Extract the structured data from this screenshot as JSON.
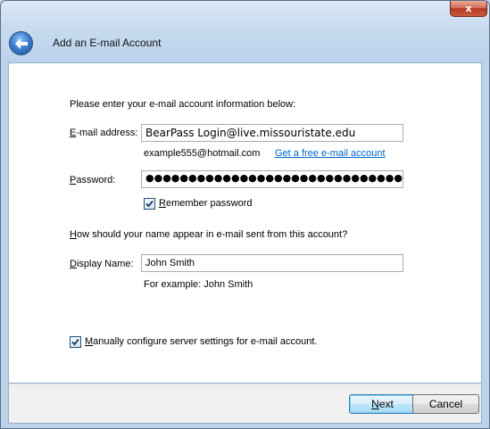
{
  "window": {
    "title": "Add an E-mail Account",
    "close_glyph": "x"
  },
  "form": {
    "intro": "Please enter your e-mail account information below:",
    "email": {
      "label_hotkey": "E",
      "label_rest": "-mail address:",
      "value": "BearPass Login@live.missouristate.edu",
      "example": "example555@hotmail.com",
      "free_link": "Get a free e-mail account"
    },
    "password": {
      "label_hotkey": "P",
      "label_rest": "assword:",
      "masked_value": "●●●●●●●●●●●●●●●●●●●●●●●●●●●●●●●●●●●●●●●●●●●●●●●",
      "remember_hotkey": "R",
      "remember_rest": "emember password",
      "remember_checked": true
    },
    "name_question_hotkey": "H",
    "name_question_rest": "ow should your name appear in e-mail sent from this account?",
    "display_name": {
      "label_hotkey": "D",
      "label_rest": "isplay Name:",
      "value": "John Smith",
      "example": "For example: John Smith"
    },
    "manual_config": {
      "hotkey": "M",
      "rest": "anually configure server settings for e-mail account.",
      "checked": true
    }
  },
  "buttons": {
    "next_hotkey": "N",
    "next_rest": "ext",
    "cancel": "Cancel"
  }
}
